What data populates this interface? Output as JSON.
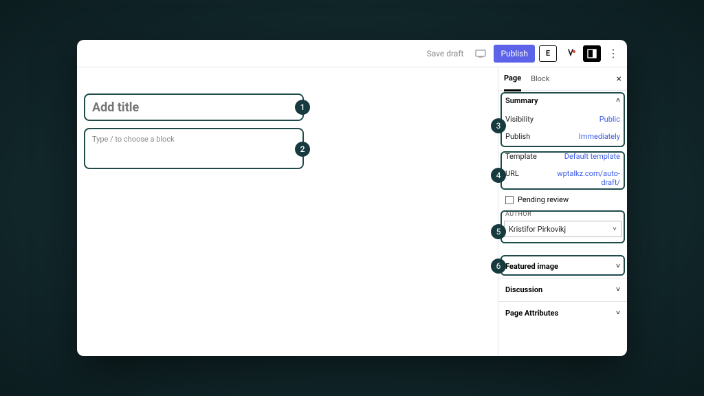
{
  "toolbar": {
    "save_draft": "Save draft",
    "publish": "Publish"
  },
  "editor": {
    "title_placeholder": "Add title",
    "block_prompt": "Type / to choose a block"
  },
  "tabs": {
    "page": "Page",
    "block": "Block"
  },
  "summary": {
    "heading": "Summary",
    "visibility_label": "Visibility",
    "visibility_value": "Public",
    "publish_label": "Publish",
    "publish_value": "Immediately",
    "template_label": "Template",
    "template_value": "Default template",
    "url_label": "URL",
    "url_value": "wptalkz.com/auto-draft/",
    "pending_review": "Pending review",
    "author_heading": "AUTHOR",
    "author_value": "Kristifor Pirkovikj"
  },
  "sections": {
    "featured_image": "Featured image",
    "discussion": "Discussion",
    "page_attributes": "Page Attributes"
  },
  "badges": {
    "b1": "1",
    "b2": "2",
    "b3": "3",
    "b4": "4",
    "b5": "5",
    "b6": "6"
  }
}
